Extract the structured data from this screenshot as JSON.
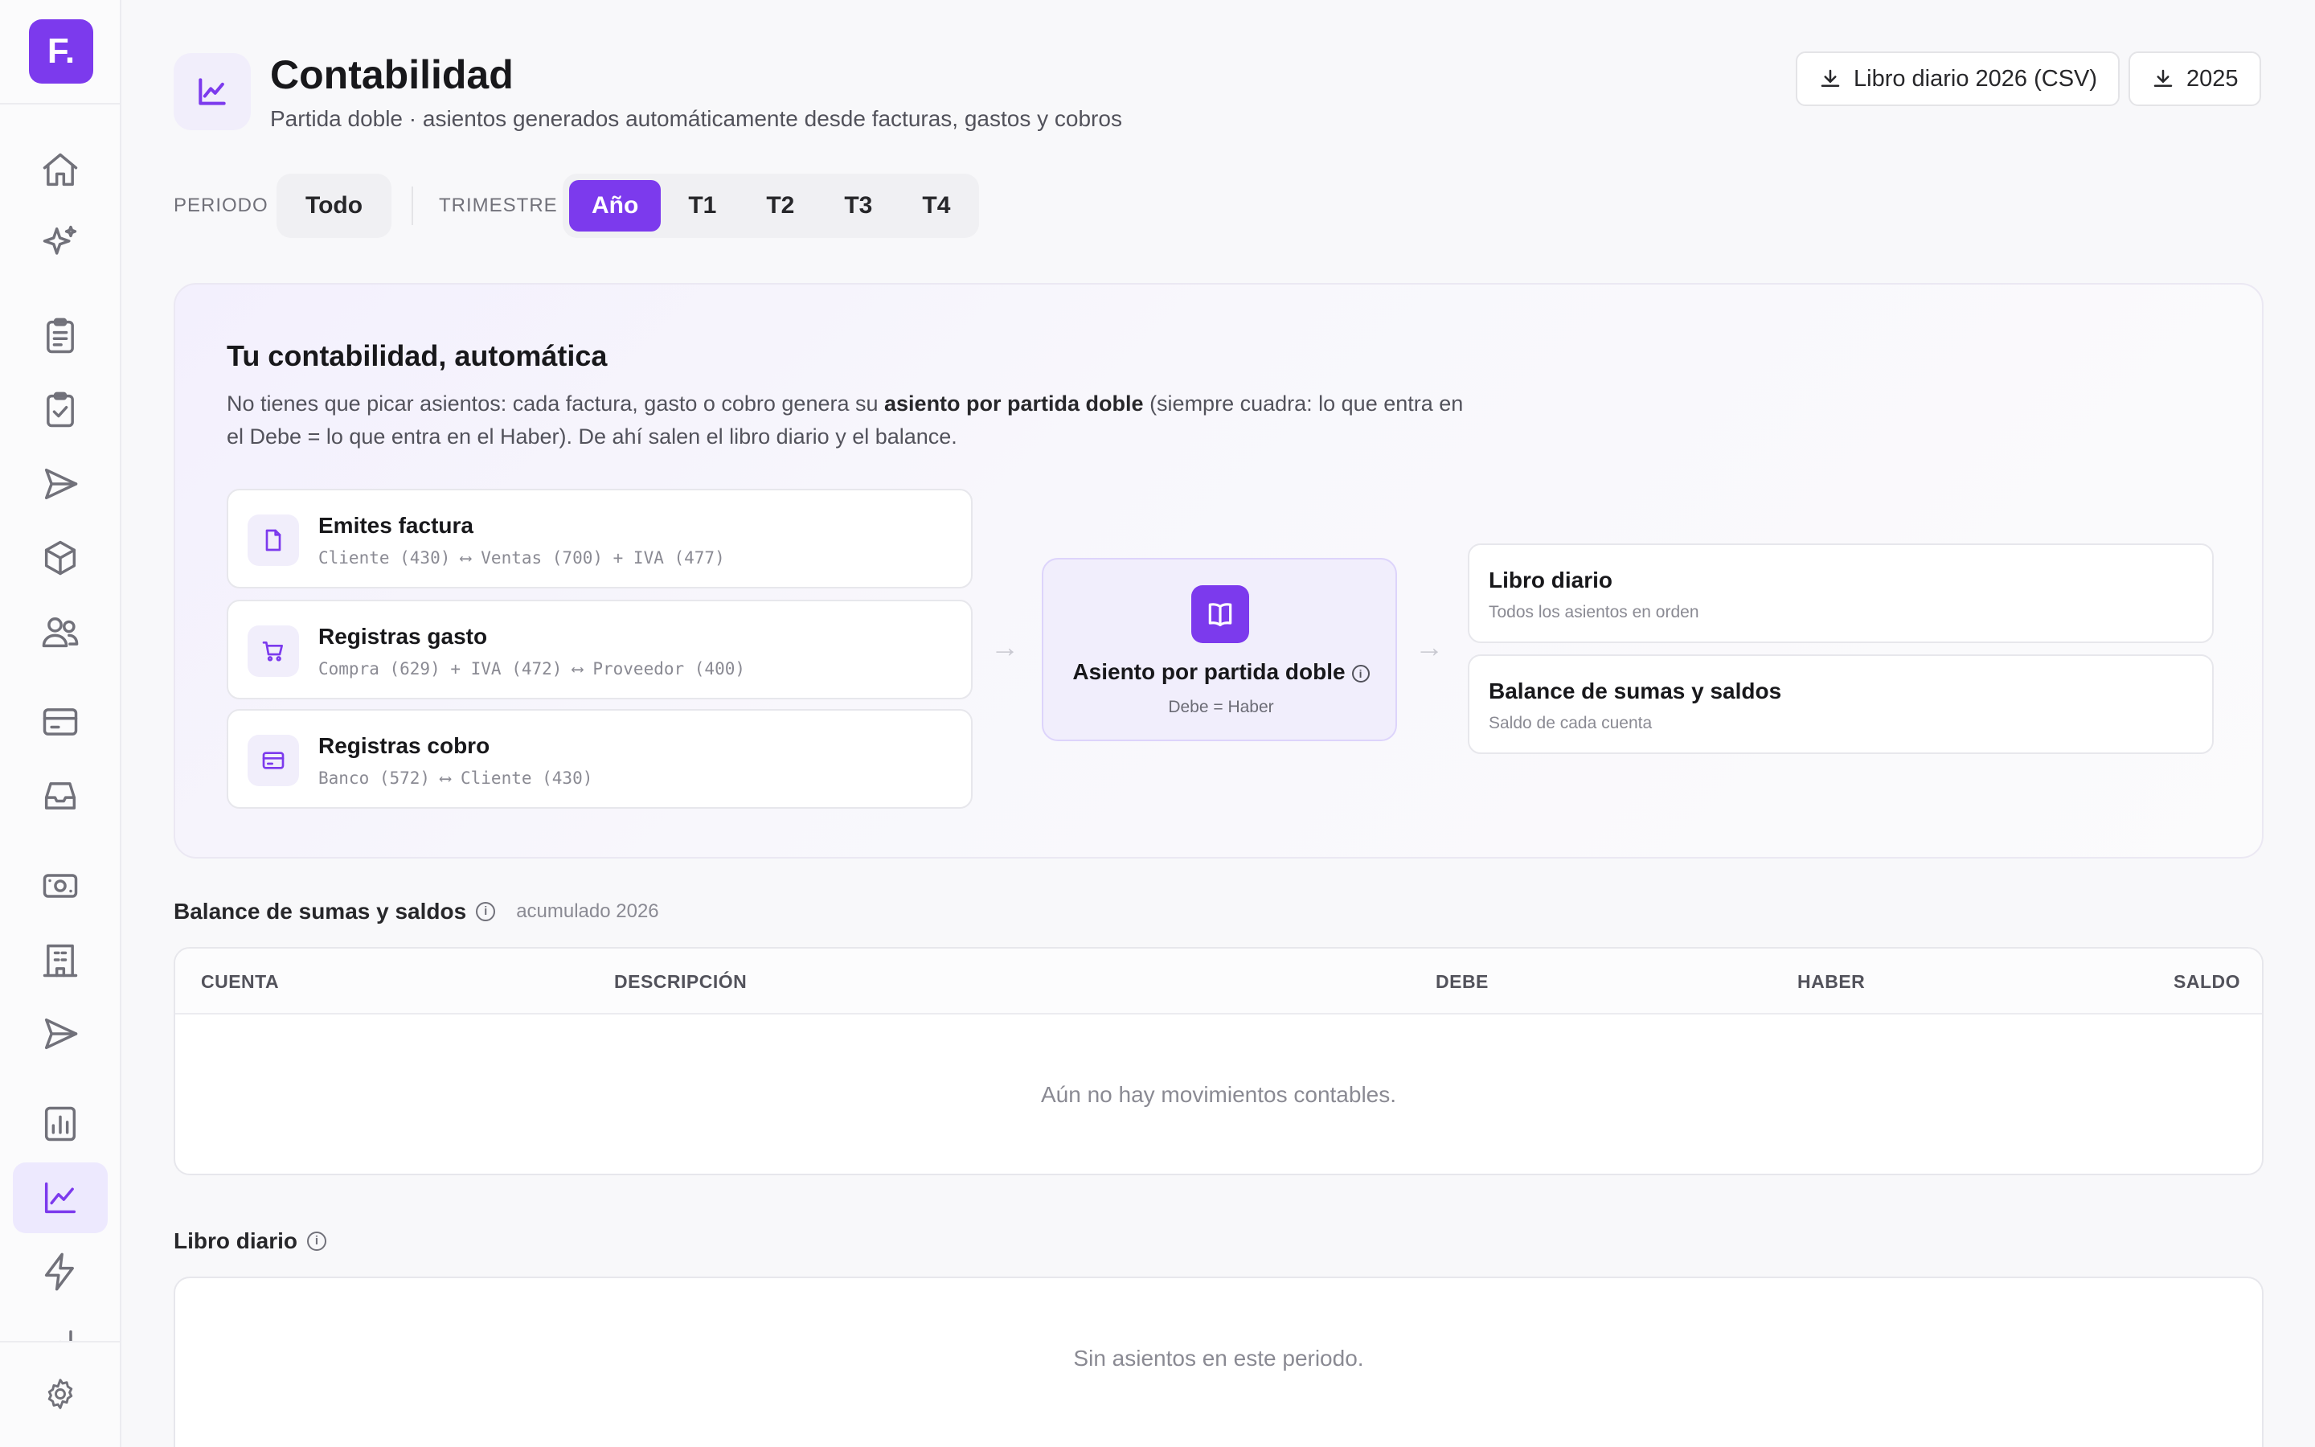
{
  "app": {
    "logo_text": "F."
  },
  "sidebar": {
    "items": [
      {
        "icon": "home-icon"
      },
      {
        "icon": "sparkles-icon"
      },
      {
        "icon": "clipboard-list-icon"
      },
      {
        "icon": "clipboard-check-icon"
      },
      {
        "icon": "send-icon"
      },
      {
        "icon": "box-icon"
      },
      {
        "icon": "users-icon"
      },
      {
        "icon": "credit-card-icon"
      },
      {
        "icon": "inbox-icon"
      },
      {
        "icon": "banknote-icon"
      },
      {
        "icon": "building-icon"
      },
      {
        "icon": "send-icon"
      },
      {
        "icon": "report-chart-icon"
      },
      {
        "icon": "line-chart-icon",
        "active": true
      },
      {
        "icon": "lightning-icon"
      },
      {
        "icon": "bar-chart-icon"
      },
      {
        "icon": "gear-icon"
      }
    ]
  },
  "header": {
    "icon": "line-chart-icon",
    "title": "Contabilidad",
    "subtitle": "Partida doble · asientos generados automáticamente desde facturas, gastos y cobros",
    "export_journal_label": "Libro diario 2026 (CSV)",
    "export_year_label": "2025"
  },
  "filters": {
    "period_label": "PERIODO",
    "period_value": "Todo",
    "quarter_label": "TRIMESTRE",
    "quarters": [
      "Año",
      "T1",
      "T2",
      "T3",
      "T4"
    ],
    "active_quarter": "Año"
  },
  "explainer": {
    "title": "Tu contabilidad, automática",
    "text_before": "No tienes que picar asientos: cada factura, gasto o cobro genera su ",
    "text_bold": "asiento por partida doble",
    "text_after": " (siempre cuadra: lo que entra en el Debe = lo que entra en el Haber). De ahí salen el libro diario y el balance.",
    "sources": [
      {
        "icon": "document-icon",
        "title": "Emites factura",
        "detail": "Cliente (430) ⟷ Ventas (700) + IVA (477)"
      },
      {
        "icon": "cart-icon",
        "title": "Registras gasto",
        "detail": "Compra (629) + IVA (472) ⟷ Proveedor (400)"
      },
      {
        "icon": "card-icon",
        "title": "Registras cobro",
        "detail": "Banco (572) ⟷ Cliente (430)"
      }
    ],
    "arrow": "→",
    "center": {
      "icon": "book-icon",
      "title": "Asiento por partida doble",
      "subtitle": "Debe = Haber"
    },
    "outputs": [
      {
        "title": "Libro diario",
        "subtitle": "Todos los asientos en orden"
      },
      {
        "title": "Balance de sumas y saldos",
        "subtitle": "Saldo de cada cuenta"
      }
    ]
  },
  "balance": {
    "title": "Balance de sumas y saldos",
    "note": "acumulado 2026",
    "columns": [
      "CUENTA",
      "DESCRIPCIÓN",
      "DEBE",
      "HABER",
      "SALDO"
    ],
    "empty": "Aún no hay movimientos contables."
  },
  "journal": {
    "title": "Libro diario",
    "empty": "Sin asientos en este periodo."
  },
  "colors": {
    "accent": "#7c3aed",
    "accent_soft": "#f1eefb"
  }
}
